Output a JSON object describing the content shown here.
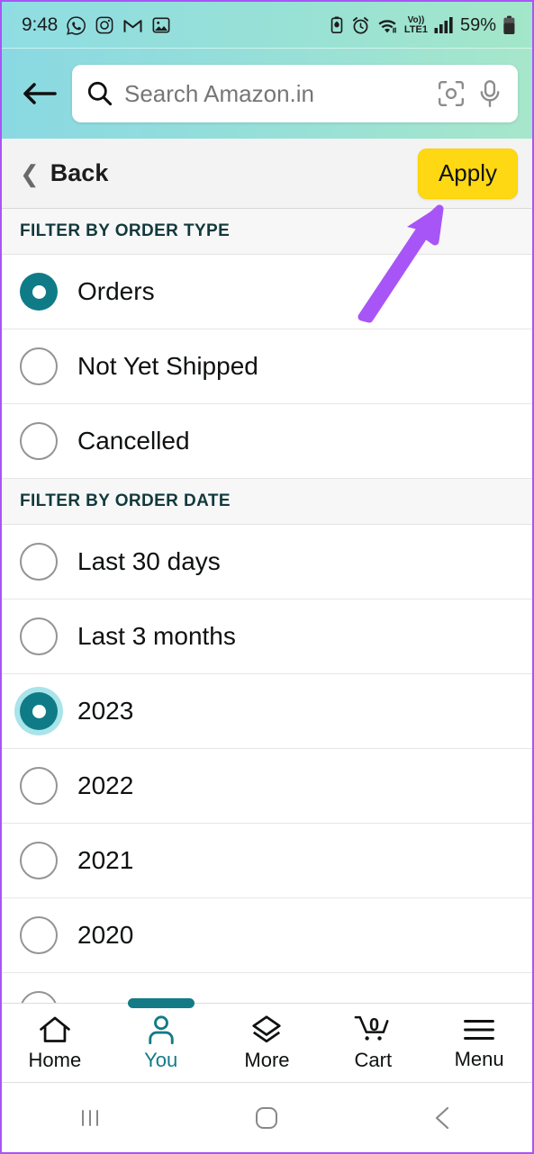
{
  "statusbar": {
    "time": "9:48",
    "left_icons": [
      "whatsapp-icon",
      "instagram-icon",
      "gmail-icon",
      "photos-icon"
    ],
    "right_icons": [
      "battery-saver-icon",
      "alarm-icon",
      "wifi-icon",
      "volte-lte1-icon",
      "signal-bars-icon"
    ],
    "volte_label": "Vo))",
    "lte_label": "LTE1",
    "battery_percent": "59%"
  },
  "search": {
    "placeholder": "Search Amazon.in",
    "back_icon": "back-arrow-icon",
    "search_icon": "search-icon",
    "camera_icon": "camera-scan-icon",
    "mic_icon": "microphone-icon"
  },
  "subheader": {
    "back_label": "Back",
    "back_chevron": "chevron-left-icon",
    "apply_label": "Apply",
    "apply_color": "#FFD814"
  },
  "annotation": {
    "arrow_color": "#A855F7",
    "points_at": "apply-button"
  },
  "sections": [
    {
      "title": "FILTER BY ORDER TYPE",
      "options": [
        {
          "label": "Orders",
          "selected": true,
          "focused": false
        },
        {
          "label": "Not Yet Shipped",
          "selected": false,
          "focused": false
        },
        {
          "label": "Cancelled",
          "selected": false,
          "focused": false
        }
      ]
    },
    {
      "title": "FILTER BY ORDER DATE",
      "options": [
        {
          "label": "Last 30 days",
          "selected": false,
          "focused": false
        },
        {
          "label": "Last 3 months",
          "selected": false,
          "focused": false
        },
        {
          "label": "2023",
          "selected": true,
          "focused": true
        },
        {
          "label": "2022",
          "selected": false,
          "focused": false
        },
        {
          "label": "2021",
          "selected": false,
          "focused": false
        },
        {
          "label": "2020",
          "selected": false,
          "focused": false
        },
        {
          "label": "",
          "selected": false,
          "focused": false
        }
      ]
    }
  ],
  "theme": {
    "accent_teal": "#0F7B86",
    "focus_halo": "#A9E4EA",
    "section_text": "#12393C",
    "header_gradient_start": "#8AD9E2",
    "header_gradient_end": "#A6E7CB"
  },
  "bottomnav": {
    "items": [
      {
        "label": "Home",
        "icon": "home-icon",
        "active": false
      },
      {
        "label": "You",
        "icon": "person-icon",
        "active": true
      },
      {
        "label": "More",
        "icon": "layers-icon",
        "active": false
      },
      {
        "label": "Cart",
        "icon": "cart-icon",
        "active": false,
        "badge": "0"
      },
      {
        "label": "Menu",
        "icon": "hamburger-icon",
        "active": false
      }
    ]
  },
  "androidnav": {
    "recents": "recents-icon",
    "home": "home-square-icon",
    "back": "back-chevron-icon"
  }
}
